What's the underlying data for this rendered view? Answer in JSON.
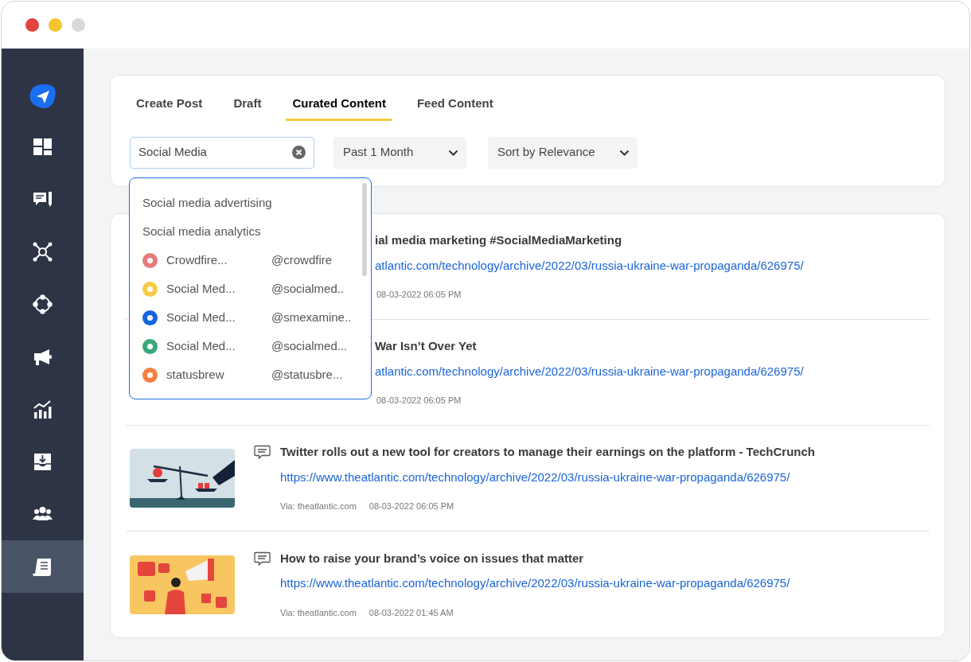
{
  "sidebar": {
    "items": [
      {
        "selected": false
      },
      {
        "selected": false
      },
      {
        "selected": false
      },
      {
        "selected": false
      },
      {
        "selected": false
      },
      {
        "selected": false
      },
      {
        "selected": false
      },
      {
        "selected": false
      },
      {
        "selected": true
      }
    ]
  },
  "tabs": [
    {
      "label": "Create Post",
      "selected": false
    },
    {
      "label": "Draft",
      "selected": false
    },
    {
      "label": "Curated Content",
      "selected": true
    },
    {
      "label": "Feed Content",
      "selected": false
    }
  ],
  "search": {
    "value": "Social Media"
  },
  "filters": [
    {
      "value": "Past 1 Month"
    },
    {
      "value": "Sort by Relevance"
    }
  ],
  "suggestions": [
    {
      "kind": "keyword",
      "label": "Social media advertising"
    },
    {
      "kind": "keyword",
      "label": "Social media analytics"
    },
    {
      "kind": "account",
      "name": "Crowdfire...",
      "handle": "@crowdfire",
      "color": "#e87b7b"
    },
    {
      "kind": "account",
      "name": "Social Med...",
      "handle": "@socialmed..",
      "color": "#f5cd45"
    },
    {
      "kind": "account",
      "name": "Social Med...",
      "handle": "@smexamine..",
      "color": "#1565e0"
    },
    {
      "kind": "account",
      "name": "Social Med...",
      "handle": "@socialmed...",
      "color": "#3aa87a"
    },
    {
      "kind": "account",
      "name": "statusbrew",
      "handle": "@statusbre...",
      "color": "#f5803e"
    }
  ],
  "posts": [
    {
      "kind": "covered",
      "title": "ial media marketing #SocialMediaMarketing",
      "url": "atlantic.com/technology/archive/2022/03/russia-ukraine-war-propaganda/626975/",
      "date": "08-03-2022 06:05 PM"
    },
    {
      "kind": "covered",
      "title": "War Isn’t Over Yet",
      "url": "atlantic.com/technology/archive/2022/03/russia-ukraine-war-propaganda/626975/",
      "date": "08-03-2022 06:05 PM"
    },
    {
      "kind": "full",
      "title": "Twitter rolls out a new tool for creators to manage their earnings on the platform - TechCrunch",
      "url": "https://www.theatlantic.com/technology/archive/2022/03/russia-ukraine-war-propaganda/626975/",
      "via": "Via: theatlantic.com",
      "date": "08-03-2022 06:05 PM"
    },
    {
      "kind": "full",
      "title": "How to raise your brand’s voice on issues that matter",
      "url": "https://www.theatlantic.com/technology/archive/2022/03/russia-ukraine-war-propaganda/626975/",
      "via": "Via: theatlantic.com",
      "date": "08-03-2022 01:45 AM"
    }
  ]
}
